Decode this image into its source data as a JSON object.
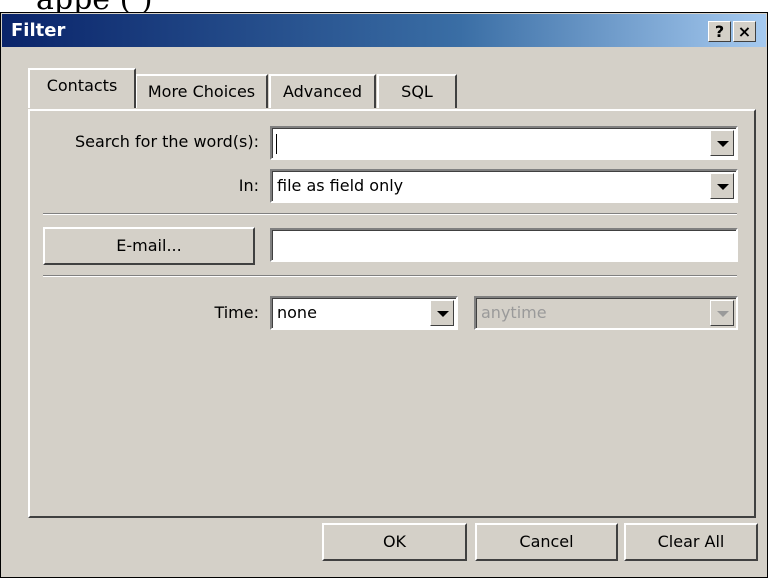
{
  "title_bar": {
    "title": "Filter",
    "help_label": "?",
    "close_label": "×"
  },
  "tabs": [
    {
      "label": "Contacts",
      "active": true
    },
    {
      "label": "More Choices",
      "active": false
    },
    {
      "label": "Advanced",
      "active": false
    },
    {
      "label": "SQL",
      "active": false
    }
  ],
  "contacts_tab": {
    "search_label": "Search for the word(s):",
    "search_value": "",
    "in_label": "In:",
    "in_value": "file as field only",
    "email_button_label": "E-mail...",
    "email_value": "",
    "time_label": "Time:",
    "time_value": "none",
    "time_range_value": "anytime",
    "time_range_enabled": false
  },
  "buttons": {
    "ok": "OK",
    "cancel": "Cancel",
    "clear_all": "Clear All"
  }
}
